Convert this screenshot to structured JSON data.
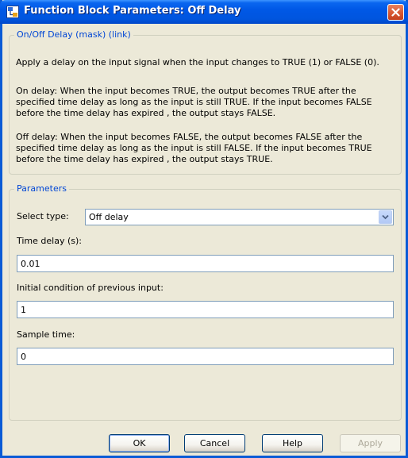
{
  "window": {
    "title": "Function Block Parameters: Off Delay"
  },
  "description": {
    "legend": "On/Off Delay  (mask) (link)",
    "line1": "Apply a delay on the input signal when the input changes to TRUE (1) or FALSE (0).",
    "on_delay": [
      "On delay: When the input becomes TRUE, the output becomes TRUE after the",
      "specified time delay as long as the input is still TRUE. If the input becomes FALSE",
      "before the time delay has expired , the output stays FALSE."
    ],
    "off_delay": [
      "Off delay: When the input becomes FALSE, the output becomes FALSE after the",
      "specified time delay as long as the input is still FALSE. If the input becomes TRUE",
      "before the time delay has expired , the output stays TRUE."
    ]
  },
  "parameters": {
    "legend": "Parameters",
    "select_type_label": "Select type:",
    "select_type_value": "Off delay",
    "time_delay_label": "Time delay (s):",
    "time_delay_value": "0.01",
    "initial_condition_label": "Initial condition of previous input:",
    "initial_condition_value": "1",
    "sample_time_label": "Sample time:",
    "sample_time_value": "0"
  },
  "buttons": {
    "ok": "OK",
    "cancel": "Cancel",
    "help": "Help",
    "apply": "Apply"
  },
  "icons": {
    "title": "simulink-block-icon",
    "close": "close-icon",
    "dropdown": "chevron-down-icon"
  },
  "colors": {
    "titlebar": "#0058e6",
    "legend_text": "#0046d5",
    "dialog_bg": "#ece9d8",
    "close_button": "#d95b35"
  }
}
